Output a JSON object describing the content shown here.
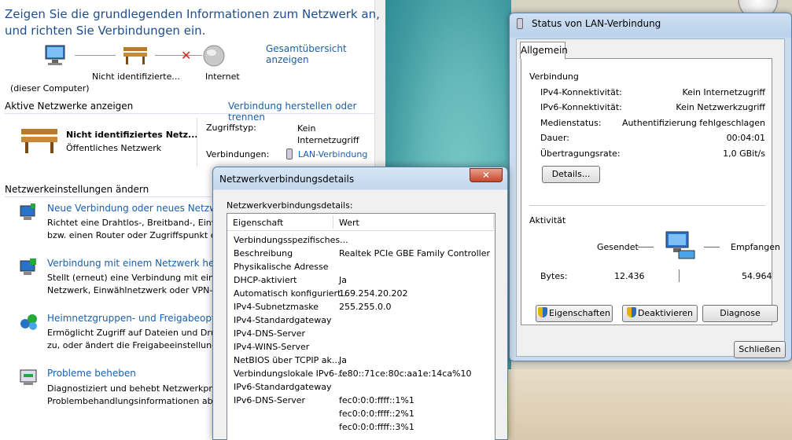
{
  "control_panel": {
    "title": "Zeigen Sie die grundlegenden Informationen zum Netzwerk an, und richten Sie Verbindungen ein.",
    "overview_link": "Gesamtübersicht anzeigen",
    "map": {
      "computer_label": "(dieser Computer)",
      "network_label": "Nicht identifizierte...",
      "internet_label": "Internet"
    },
    "active_networks": {
      "header": "Aktive Netzwerke anzeigen",
      "connect_link": "Verbindung herstellen oder trennen",
      "network_name": "Nicht identifiziertes Netz...",
      "network_type": "Öffentliches Netzwerk",
      "access_type_label": "Zugriffstyp:",
      "access_type_value": "Kein Internetzugriff",
      "connections_label": "Verbindungen:",
      "connections_value": "LAN-Verbindung"
    },
    "change_settings": {
      "header": "Netzwerkeinstellungen ändern",
      "tasks": [
        {
          "title": "Neue Verbindung oder neues Netzwerk e",
          "desc1": "Richtet eine Drahtlos-, Breitband-, Einwa",
          "desc2": "bzw. einen Router oder Zugriffspunkt ei"
        },
        {
          "title": "Verbindung mit einem Netzwerk herste",
          "desc1": "Stellt (erneut) eine Verbindung mit eine",
          "desc2": "Netzwerk, Einwählnetzwerk oder VPN-N"
        },
        {
          "title": "Heimnetzgruppen- und Freigabeoption",
          "desc1": "Ermöglicht Zugriff auf Dateien und Dru",
          "desc2": "zu, oder ändert die Freigabeeinstellunge"
        },
        {
          "title": "Probleme beheben",
          "desc1": "Diagnostiziert und behebt Netzwerkpro",
          "desc2": "Problembehandlungsinformationen ab."
        }
      ]
    }
  },
  "lan_status": {
    "title": "Status von LAN-Verbindung",
    "tab": "Allgemein",
    "connection_header": "Verbindung",
    "rows": [
      {
        "label": "IPv4-Konnektivität:",
        "value": "Kein Internetzugriff"
      },
      {
        "label": "IPv6-Konnektivität:",
        "value": "Kein Netzwerkzugriff"
      },
      {
        "label": "Medienstatus:",
        "value": "Authentifizierung fehlgeschlagen"
      },
      {
        "label": "Dauer:",
        "value": "00:04:01"
      },
      {
        "label": "Übertragungsrate:",
        "value": "1,0 GBit/s"
      }
    ],
    "details_button": "Details...",
    "activity_header": "Aktivität",
    "sent_label": "Gesendet",
    "received_label": "Empfangen",
    "bytes_label": "Bytes:",
    "bytes_sent": "12.436",
    "bytes_received": "54.964",
    "properties_button": "Eigenschaften",
    "deactivate_button": "Deaktivieren",
    "diagnose_button": "Diagnose",
    "close_button": "Schließen"
  },
  "details_dialog": {
    "title": "Netzwerkverbindungsdetails",
    "close_glyph": "✕",
    "label": "Netzwerkverbindungsdetails:",
    "col_property": "Eigenschaft",
    "col_value": "Wert",
    "rows": [
      {
        "property": "Verbindungsspezifisches...",
        "value": ""
      },
      {
        "property": "Beschreibung",
        "value": "Realtek PCIe GBE Family Controller"
      },
      {
        "property": "Physikalische Adresse",
        "value": ""
      },
      {
        "property": "DHCP-aktiviert",
        "value": "Ja"
      },
      {
        "property": "Automatisch konfiguriert...",
        "value": "169.254.20.202"
      },
      {
        "property": "IPv4-Subnetzmaske",
        "value": "255.255.0.0"
      },
      {
        "property": "IPv4-Standardgateway",
        "value": ""
      },
      {
        "property": "IPv4-DNS-Server",
        "value": ""
      },
      {
        "property": "IPv4-WINS-Server",
        "value": ""
      },
      {
        "property": "NetBIOS über TCPIP ak...",
        "value": "Ja"
      },
      {
        "property": "Verbindungslokale IPv6-...",
        "value": "fe80::71ce:80c:aa1e:14ca%10"
      },
      {
        "property": "IPv6-Standardgateway",
        "value": ""
      },
      {
        "property": "IPv6-DNS-Server",
        "value": "fec0:0:0:ffff::1%1"
      },
      {
        "property": "",
        "value": "fec0:0:0:ffff::2%1"
      },
      {
        "property": "",
        "value": "fec0:0:0:ffff::3%1"
      }
    ]
  },
  "colors": {
    "link": "#1a5fa8",
    "header": "#1e4f8c",
    "error_x": "#e0221b"
  }
}
